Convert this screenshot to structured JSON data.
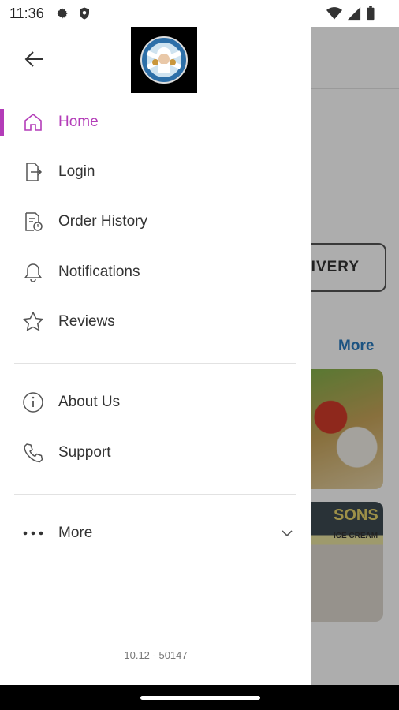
{
  "status_bar": {
    "time": "11:36",
    "icons_left": [
      "gear-icon",
      "shield-icon"
    ],
    "icons_right": [
      "wifi-icon",
      "signal-icon",
      "battery-icon"
    ]
  },
  "drawer": {
    "menu": [
      {
        "label": "Home",
        "icon": "home-icon",
        "active": true
      },
      {
        "label": "Login",
        "icon": "login-icon",
        "active": false
      },
      {
        "label": "Order History",
        "icon": "order-history-icon",
        "active": false
      },
      {
        "label": "Notifications",
        "icon": "bell-icon",
        "active": false
      },
      {
        "label": "Reviews",
        "icon": "star-icon",
        "active": false
      }
    ],
    "secondary": [
      {
        "label": "About Us",
        "icon": "info-icon"
      },
      {
        "label": "Support",
        "icon": "phone-icon"
      }
    ],
    "more": {
      "label": "More",
      "icon": "more-dots-icon"
    },
    "version": "10.12 - 50147"
  },
  "background_app": {
    "delivery_button": "LIVERY",
    "more_link": "More",
    "card_text": "SONS",
    "card_subtext": "ICE CREAM"
  },
  "colors": {
    "accent": "#b33cb8",
    "link": "#2a7bbf"
  }
}
